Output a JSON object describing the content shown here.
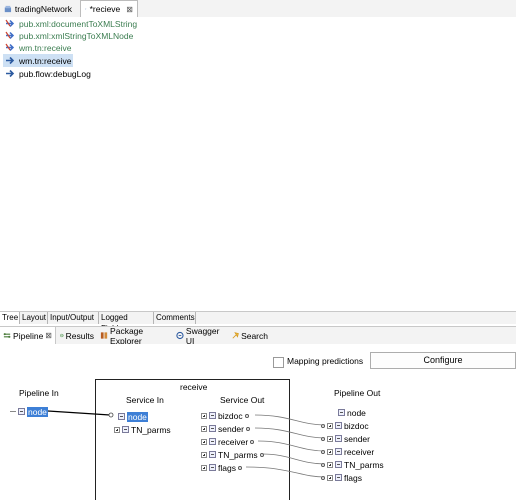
{
  "editor_tabs": [
    {
      "label": "tradingNetwork",
      "icon": "package-icon",
      "active": false
    },
    {
      "label": "*recieve",
      "icon": "flow-service-icon",
      "active": true,
      "close": "⊠"
    }
  ],
  "flow_steps": [
    {
      "label": "pub.xml:documentToXMLString",
      "icon": "invoke-disabled-icon",
      "disabled": true
    },
    {
      "label": "pub.xml:xmlStringToXMLNode",
      "icon": "invoke-disabled-icon",
      "disabled": true
    },
    {
      "label": "wm.tn:receive",
      "icon": "invoke-disabled-icon",
      "disabled": true
    },
    {
      "label": "wm.tn:receive",
      "icon": "invoke-icon",
      "selected": true
    },
    {
      "label": "pub.flow:debugLog",
      "icon": "invoke-icon"
    }
  ],
  "bottom_tabs": [
    "Tree",
    "Layout",
    "Input/Output",
    "Logged Fields",
    "Comments"
  ],
  "view_tabs": [
    {
      "label": "Pipeline",
      "icon": "pipeline-icon",
      "active": true,
      "close": "⊠"
    },
    {
      "label": "Results",
      "icon": "results-icon"
    },
    {
      "label": "Package Explorer",
      "icon": "package-explorer-icon"
    },
    {
      "label": "Swagger UI",
      "icon": "swagger-icon"
    },
    {
      "label": "Search",
      "icon": "search-icon"
    }
  ],
  "pipeline": {
    "mapping_predictions_label": "Mapping predictions",
    "mapping_predictions_checked": false,
    "configure_label": "Configure",
    "pipeline_in_title": "Pipeline In",
    "pipeline_in_fields": [
      "node"
    ],
    "service_title": "receive",
    "service_in_title": "Service In",
    "service_in_fields": [
      "node",
      "TN_parms"
    ],
    "service_out_title": "Service Out",
    "service_out_fields": [
      "bizdoc",
      "sender",
      "receiver",
      "TN_parms",
      "flags"
    ],
    "pipeline_out_title": "Pipeline Out",
    "pipeline_out_fields": [
      "node",
      "bizdoc",
      "sender",
      "receiver",
      "TN_parms",
      "flags"
    ]
  },
  "colors": {
    "selection": "#3d7fd6",
    "disabled_text": "#3b7d50",
    "selected_row": "#cde0f4"
  }
}
